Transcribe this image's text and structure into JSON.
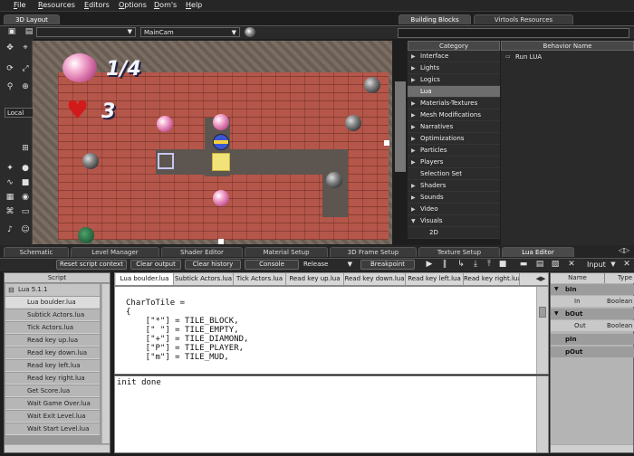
{
  "menu": [
    "File",
    "Resources",
    "Editors",
    "Options",
    "Dom's",
    "Help"
  ],
  "layout": {
    "tab": "3D Layout",
    "camera_select": "MainCam",
    "mode_select": "Local"
  },
  "game": {
    "gem_counter": "1/4",
    "lives": "3"
  },
  "building_blocks": {
    "tabs": [
      "Building Blocks",
      "Virtools Resources"
    ],
    "category_header": "Category",
    "behavior_header": "Behavior Name",
    "categories": [
      {
        "label": "Interface",
        "arrow": "▶"
      },
      {
        "label": "Lights",
        "arrow": "▶"
      },
      {
        "label": "Logics",
        "arrow": "▶"
      },
      {
        "label": "Lua",
        "arrow": ""
      },
      {
        "label": "Materials-Textures",
        "arrow": "▶"
      },
      {
        "label": "Mesh Modifications",
        "arrow": "▶"
      },
      {
        "label": "Narratives",
        "arrow": "▶"
      },
      {
        "label": "Optimizations",
        "arrow": "▶"
      },
      {
        "label": "Particles",
        "arrow": "▶"
      },
      {
        "label": "Players",
        "arrow": "▶"
      },
      {
        "label": "Selection Set",
        "arrow": ""
      },
      {
        "label": "Shaders",
        "arrow": "▶"
      },
      {
        "label": "Sounds",
        "arrow": "▶"
      },
      {
        "label": "Video",
        "arrow": "▶"
      },
      {
        "label": "Visuals",
        "arrow": "▼"
      },
      {
        "label": "2D",
        "arrow": ""
      }
    ],
    "selected_category": "Lua",
    "behaviors": [
      "Run LUA"
    ]
  },
  "editor_tabs": [
    "Schematic",
    "Level Manager",
    "Shader Editor",
    "Material Setup",
    "3D Frame Setup",
    "Texture Setup",
    "Lua Editor"
  ],
  "toolbar": {
    "reset_script_context": "Reset script context",
    "clear_output": "Clear output",
    "clear_history": "Clear history",
    "console": "Console",
    "release": "Release",
    "breakpoint": "Breakpoint",
    "input": "Input"
  },
  "script_panel": {
    "header": "Script",
    "root": "Lua 5.1.1",
    "items": [
      "Lua boulder.lua",
      "Subtick Actors.lua",
      "Tick Actors.lua",
      "Read key up.lua",
      "Read key down.lua",
      "Read key left.lua",
      "Read key right.lua",
      "Get Score.lua",
      "Wait Game Over.lua",
      "Wait Exit Level.lua",
      "Wait Start Level.lua"
    ]
  },
  "file_tabs": [
    "Lua boulder.lua",
    "Subtick Actors.lua",
    "Tick Actors.lua",
    "Read key up.lua",
    "Read key down.lua",
    "Read key left.lua",
    "Read key right.lua"
  ],
  "code_lines": [
    "CharToTile =",
    "{",
    "    [\"*\"] = TILE_BLOCK,",
    "    [\" \"] = TILE_EMPTY,",
    "    [\"+\"] = TILE_DIAMOND,",
    "    [\"P\"] = TILE_PLAYER,",
    "    [\"m\"] = TILE_MUD,"
  ],
  "output_text": "init done",
  "params": {
    "name_header": "Name",
    "type_header": "Type",
    "bIn": "bIn",
    "in_name": "In",
    "in_type": "Boolean",
    "bOut": "bOut",
    "out_name": "Out",
    "out_type": "Boolean",
    "pIn": "pIn",
    "pOut": "pOut"
  }
}
